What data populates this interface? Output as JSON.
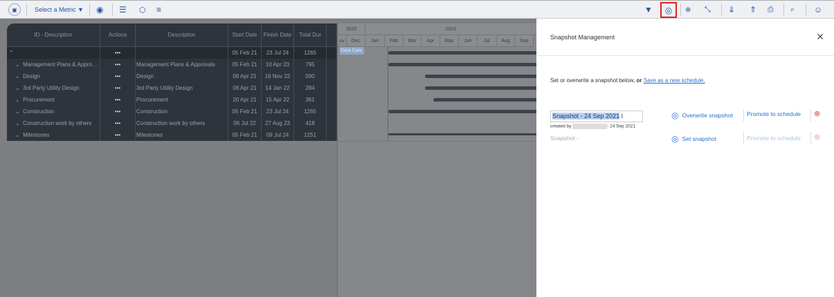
{
  "toolbar": {
    "metric_label": "Select a Metric",
    "icons": [
      "home-icon",
      "eye-icon",
      "gantt-icon",
      "cube-icon",
      "sliders-icon",
      "filter-icon",
      "snapshot-icon",
      "baseline-icon",
      "collapse-icon",
      "import-icon",
      "export-icon",
      "print-icon",
      "search-icon",
      "help-icon"
    ]
  },
  "table": {
    "headers": [
      "ID - Description",
      "Actions",
      "Description",
      "Start Date",
      "Finish Date",
      "Total Dur"
    ],
    "rows": [
      {
        "id": "",
        "actions": "•••",
        "desc": "",
        "start": "05 Feb 21",
        "finish": "23 Jul 24",
        "dur": "1265"
      },
      {
        "id": "Management Plans & Appro…",
        "actions": "•••",
        "desc": "Management Plans & Approvals",
        "start": "05 Feb 21",
        "finish": "10 Apr 23",
        "dur": "795"
      },
      {
        "id": "Design",
        "actions": "•••",
        "desc": "Design",
        "start": "06 Apr 21",
        "finish": "16 Nov 22",
        "dur": "590"
      },
      {
        "id": "3rd Party Utility Design",
        "actions": "•••",
        "desc": "3rd Party Utility Design",
        "start": "06 Apr 21",
        "finish": "14 Jan 22",
        "dur": "284"
      },
      {
        "id": "Procurement",
        "actions": "•••",
        "desc": "Procurement",
        "start": "20 Apr 21",
        "finish": "15 Apr 22",
        "dur": "361"
      },
      {
        "id": "Construction",
        "actions": "•••",
        "desc": "Construction",
        "start": "05 Feb 21",
        "finish": "23 Jul 24",
        "dur": "1265"
      },
      {
        "id": "Construction work by others",
        "actions": "•••",
        "desc": "Construction work by others",
        "start": "06 Jul 22",
        "finish": "27 Aug 23",
        "dur": "418"
      },
      {
        "id": "Milestones",
        "actions": "•••",
        "desc": "Milestones",
        "start": "05 Feb 21",
        "finish": "09 Jul 24",
        "dur": "1251"
      }
    ]
  },
  "gantt": {
    "years": [
      "2020",
      "2021"
    ],
    "months": [
      "ov",
      "Dec",
      "Jan",
      "Feb",
      "Mar",
      "Apr",
      "May",
      "Jun",
      "Jul",
      "Aug",
      "Sep"
    ],
    "data_date_label": "Data Date"
  },
  "panel": {
    "title": "Snapshot Management",
    "intro": "Set or overwrite a snapshot below,",
    "intro_or": "or",
    "link": "Save as a new schedule.",
    "snap1": {
      "name": "Snapshot - 24 Sep 2021",
      "created_by": "created by",
      "created_date": "- 24 Sep 2021",
      "overwrite": "Overwrite snapshot",
      "promote": "Promote to schedule"
    },
    "snap2": {
      "name": "Snapshot -",
      "set": "Set snapshot",
      "promote": "Promote to schedule"
    }
  }
}
